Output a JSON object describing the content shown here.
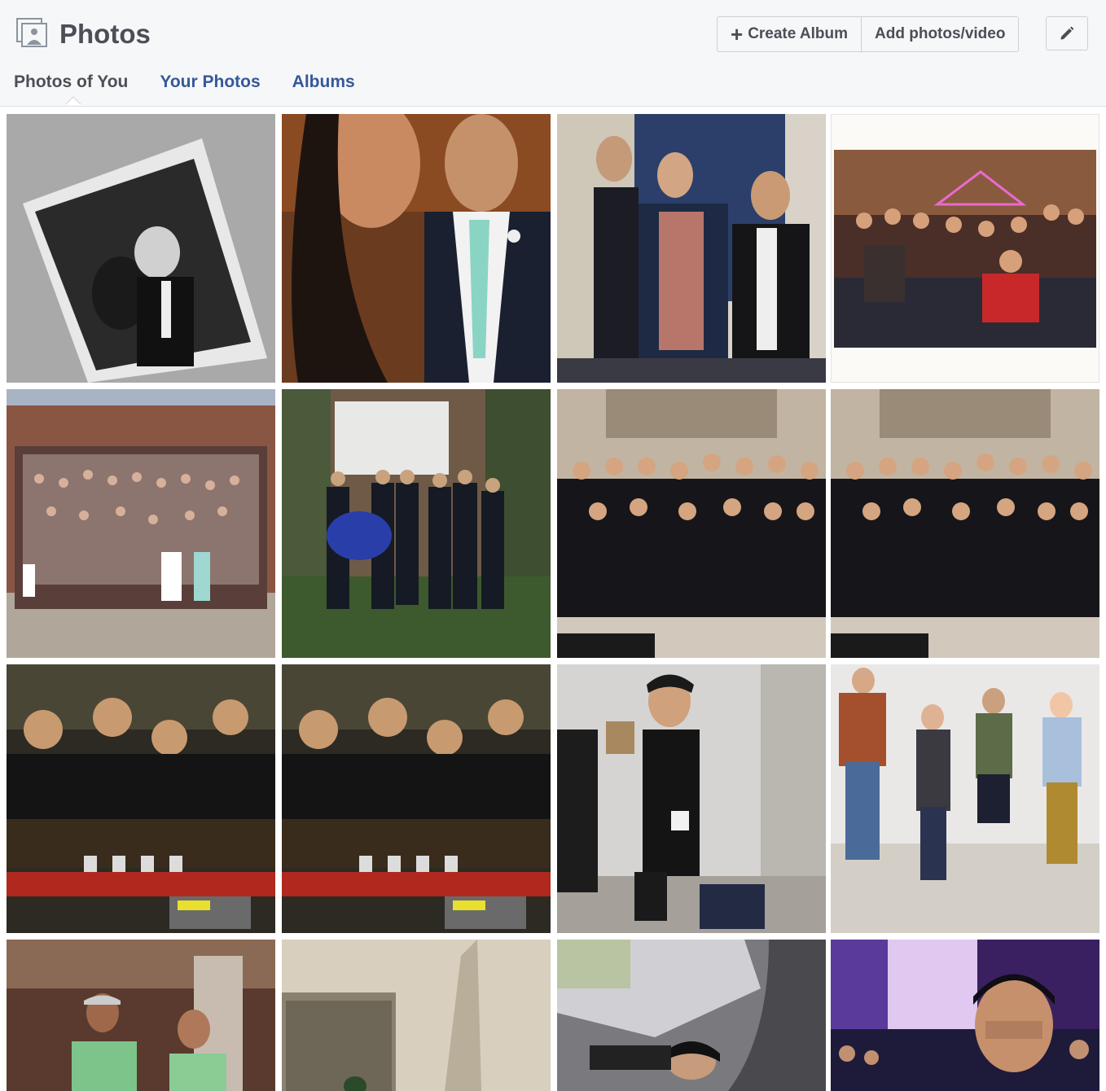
{
  "header": {
    "title": "Photos",
    "create_album_label": "Create Album",
    "add_photos_label": "Add photos/video"
  },
  "tabs": [
    {
      "label": "Photos of You",
      "active": true
    },
    {
      "label": "Your Photos",
      "active": false
    },
    {
      "label": "Albums",
      "active": false
    }
  ],
  "colors": {
    "link": "#365899",
    "text": "#4b4f56",
    "background": "#f6f7f9"
  },
  "photos": [
    {
      "name": "photo-bw-prom-polaroid"
    },
    {
      "name": "photo-prom-selfie"
    },
    {
      "name": "photo-group-suits-event"
    },
    {
      "name": "photo-holiday-dinner"
    },
    {
      "name": "photo-wedding-crowd"
    },
    {
      "name": "photo-garden-suits"
    },
    {
      "name": "photo-team-stage-1"
    },
    {
      "name": "photo-team-stage-2"
    },
    {
      "name": "photo-bar-group-1"
    },
    {
      "name": "photo-bar-group-2"
    },
    {
      "name": "photo-hallway-boy"
    },
    {
      "name": "photo-jumping-group"
    },
    {
      "name": "photo-restaurant-pair"
    },
    {
      "name": "photo-room-corner"
    },
    {
      "name": "photo-car-seat"
    },
    {
      "name": "photo-purple-party"
    }
  ]
}
